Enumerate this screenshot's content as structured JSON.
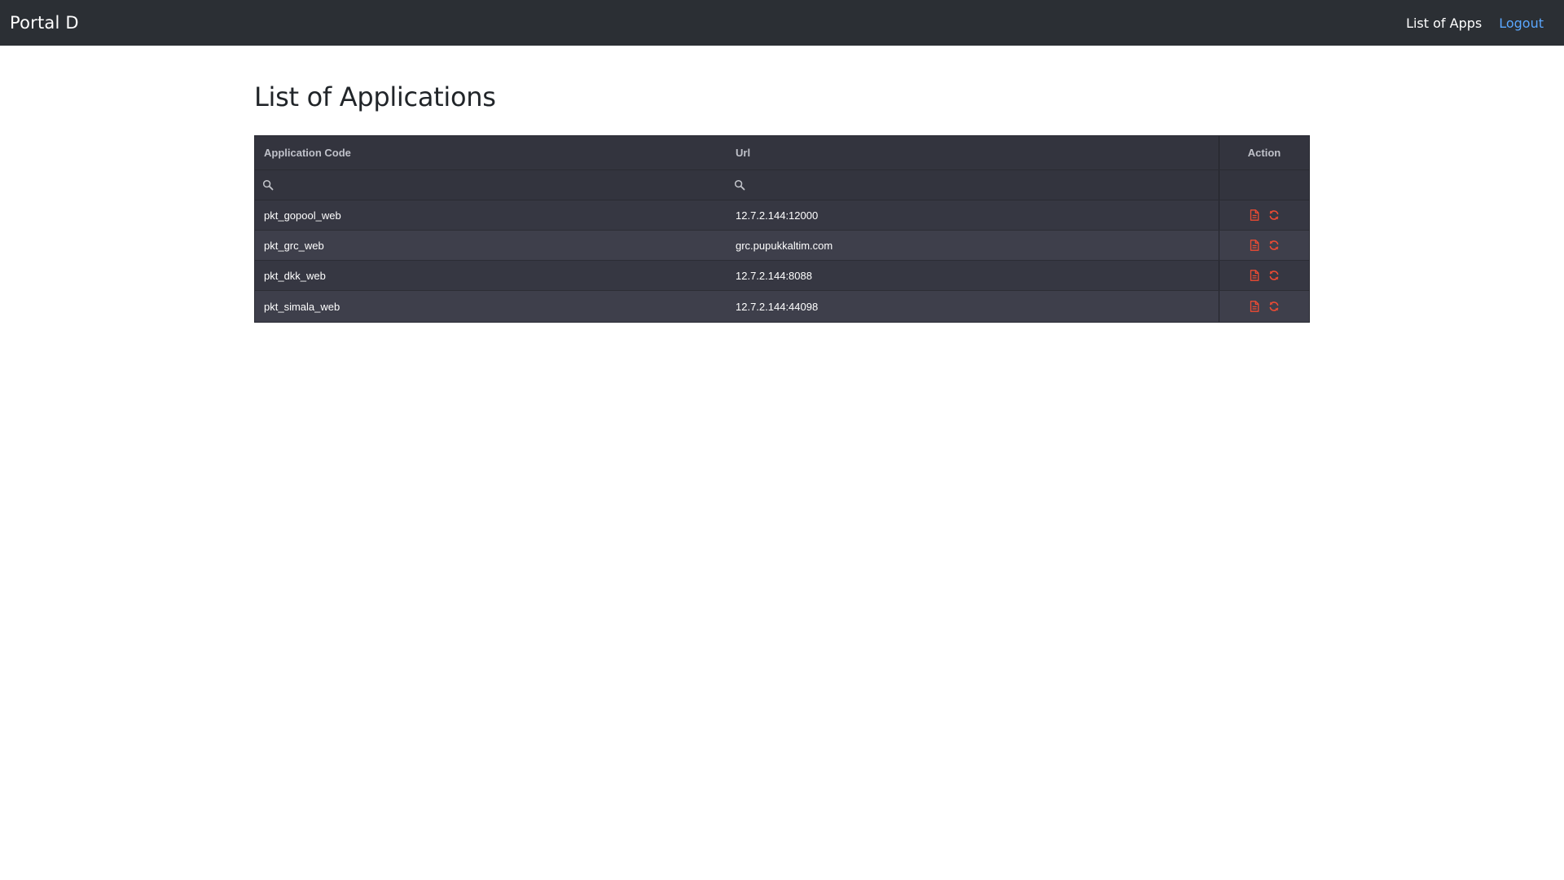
{
  "app": {
    "brand": "Portal D"
  },
  "nav": {
    "list_of_apps": "List of Apps",
    "logout": "Logout"
  },
  "page": {
    "title": "List of Applications"
  },
  "table": {
    "columns": {
      "code": "Application Code",
      "url": "Url",
      "action": "Action"
    },
    "filters": {
      "code_value": "",
      "url_value": ""
    },
    "rows": [
      {
        "code": "pkt_gopool_web",
        "url": "12.7.2.144:12000"
      },
      {
        "code": "pkt_grc_web",
        "url": "grc.pupukkaltim.com"
      },
      {
        "code": "pkt_dkk_web",
        "url": "12.7.2.144:8088"
      },
      {
        "code": "pkt_simala_web",
        "url": "12.7.2.144:44098"
      }
    ],
    "row_actions": [
      "file-icon",
      "refresh-icon"
    ]
  },
  "colors": {
    "navbar_bg": "#2b2f34",
    "logout_link": "#5aa7ff",
    "action_icon": "#ef4b33",
    "grid_bg": "#343540"
  }
}
